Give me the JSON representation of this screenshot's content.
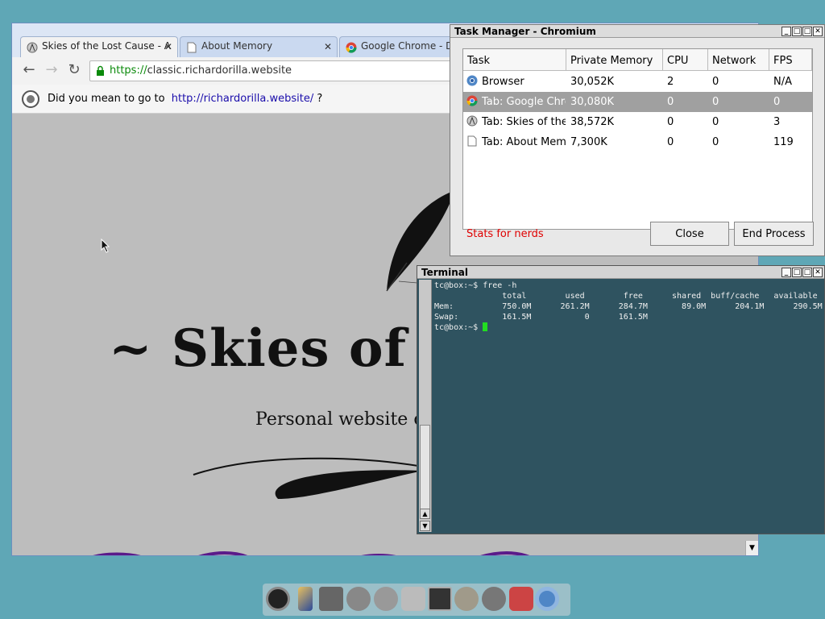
{
  "browser": {
    "tabs": [
      {
        "title": "Skies of the Lost Cause - A",
        "icon": "site-logo-icon",
        "active": true
      },
      {
        "title": "About Memory",
        "icon": "page-icon",
        "active": false
      },
      {
        "title": "Google Chrome - Dow",
        "icon": "chrome-icon",
        "active": false
      }
    ],
    "url_scheme": "https://",
    "url_host": "classic.richardorilla.website",
    "infobar": {
      "text": "Did you mean to go to",
      "link": "http://richardorilla.website/",
      "suffix": "?"
    },
    "page": {
      "title": "~ Skies of the L",
      "subtitle": "Personal website of R"
    }
  },
  "task_manager": {
    "title": "Task Manager - Chromium",
    "columns": [
      "Task",
      "Private Memory",
      "CPU",
      "Network",
      "FPS"
    ],
    "rows": [
      {
        "task": "Browser",
        "memory": "30,052K",
        "cpu": "2",
        "network": "0",
        "fps": "N/A",
        "icon": "chromium-icon",
        "selected": false
      },
      {
        "task": "Tab: Google Chro",
        "memory": "30,080K",
        "cpu": "0",
        "network": "0",
        "fps": "0",
        "icon": "chrome-icon",
        "selected": true
      },
      {
        "task": "Tab: Skies of the",
        "memory": "38,572K",
        "cpu": "0",
        "network": "0",
        "fps": "3",
        "icon": "site-logo-icon",
        "selected": false
      },
      {
        "task": "Tab: About Memo",
        "memory": "7,300K",
        "cpu": "0",
        "network": "0",
        "fps": "119",
        "icon": "page-icon",
        "selected": false
      }
    ],
    "stats_link": "Stats for nerds",
    "close_label": "Close",
    "end_process_label": "End Process"
  },
  "terminal": {
    "title": "Terminal",
    "lines": [
      "tc@box:~$ free -h",
      "              total        used        free      shared  buff/cache   available",
      "Mem:          750.0M      261.2M      284.7M       89.0M      204.1M      290.5M",
      "Swap:         161.5M           0      161.5M"
    ],
    "prompt": "tc@box:~$ "
  },
  "dock": {
    "items": [
      "power-icon",
      "paint-brush-icon",
      "control-panel-icon",
      "apps-install-icon",
      "run-icon",
      "mount-tool-icon",
      "terminal-icon",
      "ezremaster-icon",
      "editor-icon",
      "wifi-icon",
      "chromium-icon"
    ]
  }
}
